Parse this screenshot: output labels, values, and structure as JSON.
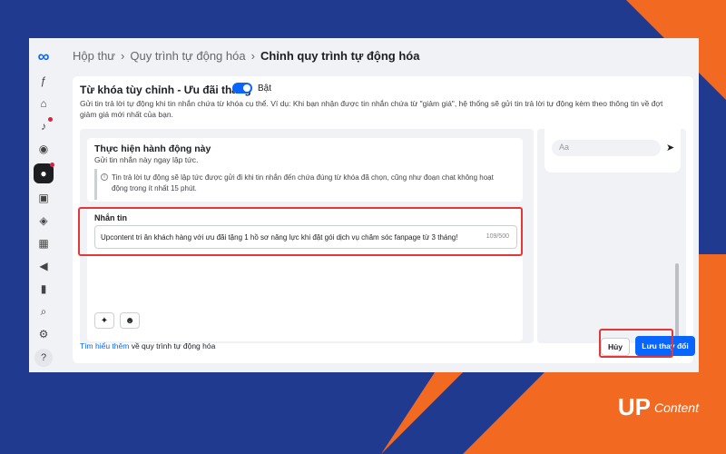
{
  "breadcrumb": {
    "inbox": "Hộp thư",
    "automation": "Quy trình tự động hóa",
    "current": "Chỉnh quy trình tự động hóa"
  },
  "keyword": {
    "title": "Từ khóa tùy chỉnh - Ưu đãi tháng",
    "toggle_label": "Bật",
    "toggle_on": true,
    "description": "Gửi tin trả lời tự động khi tin nhắn chứa từ khóa cụ thể. Ví dụ: Khi bạn nhận được tin nhắn chứa từ \"giảm giá\", hệ thống sẽ gửi tin trả lời tự động kèm theo thông tin về đợt giảm giá mới nhất của bạn."
  },
  "action": {
    "title": "Thực hiện hành động này",
    "subtitle": "Gửi tin nhắn này ngay lập tức.",
    "info": "Tin trả lời tự động sẽ lập tức được gửi đi khi tin nhắn đến chứa đúng từ khóa đã chọn, cũng như đoạn chat không hoạt động trong ít nhất 15 phút."
  },
  "message": {
    "label": "Nhắn tin",
    "value": "Upcontent tri ân khách hàng với ưu đãi tặng 1 hồ sơ năng lực khi đặt gói dịch vụ chăm sóc fanpage từ 3 tháng!",
    "count": "109/500"
  },
  "preview": {
    "placeholder": "Aa"
  },
  "footer": {
    "learn_more": "Tìm hiểu thêm",
    "learn_more_rest": " về quy trình tự động hóa",
    "cancel": "Hủy",
    "save": "Lưu thay đổi"
  },
  "brand": {
    "mark": "UP",
    "text": "Content"
  },
  "icons": {
    "nav": [
      "meta-logo-icon",
      "facebook-icon",
      "home-icon",
      "bell-icon",
      "compass-icon",
      "messenger-icon",
      "pages-icon",
      "ads-icon",
      "grid-icon",
      "megaphone-icon",
      "insights-icon",
      "search-icon",
      "settings-icon",
      "help-icon"
    ]
  },
  "colors": {
    "accent": "#0866ff",
    "highlight": "#e23838",
    "bg_blue": "#203a8f",
    "bg_orange": "#f26a21"
  }
}
